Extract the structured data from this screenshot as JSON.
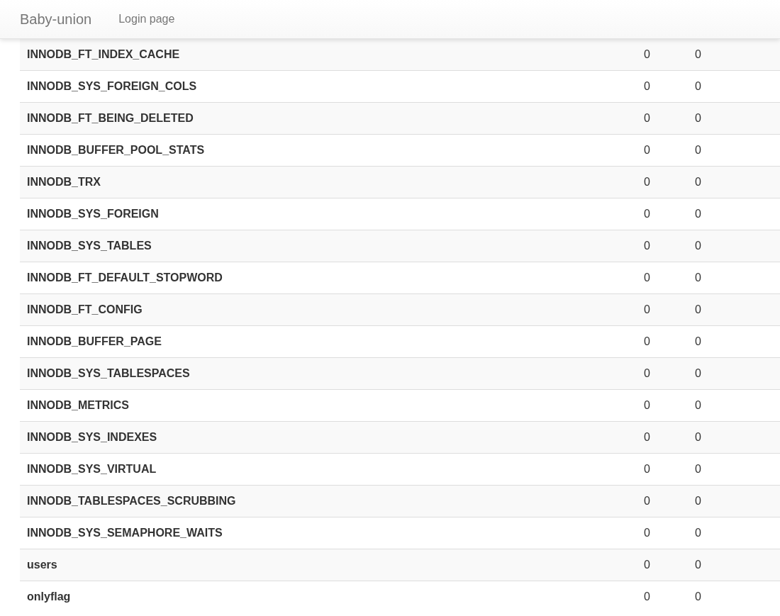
{
  "navbar": {
    "brand": "Baby-union",
    "links": [
      "Login page"
    ]
  },
  "table": {
    "rows": [
      [
        "INNODB_FT_INDEX_CACHE",
        "0",
        "0"
      ],
      [
        "INNODB_SYS_FOREIGN_COLS",
        "0",
        "0"
      ],
      [
        "INNODB_FT_BEING_DELETED",
        "0",
        "0"
      ],
      [
        "INNODB_BUFFER_POOL_STATS",
        "0",
        "0"
      ],
      [
        "INNODB_TRX",
        "0",
        "0"
      ],
      [
        "INNODB_SYS_FOREIGN",
        "0",
        "0"
      ],
      [
        "INNODB_SYS_TABLES",
        "0",
        "0"
      ],
      [
        "INNODB_FT_DEFAULT_STOPWORD",
        "0",
        "0"
      ],
      [
        "INNODB_FT_CONFIG",
        "0",
        "0"
      ],
      [
        "INNODB_BUFFER_PAGE",
        "0",
        "0"
      ],
      [
        "INNODB_SYS_TABLESPACES",
        "0",
        "0"
      ],
      [
        "INNODB_METRICS",
        "0",
        "0"
      ],
      [
        "INNODB_SYS_INDEXES",
        "0",
        "0"
      ],
      [
        "INNODB_SYS_VIRTUAL",
        "0",
        "0"
      ],
      [
        "INNODB_TABLESPACES_SCRUBBING",
        "0",
        "0"
      ],
      [
        "INNODB_SYS_SEMAPHORE_WAITS",
        "0",
        "0"
      ],
      [
        "users",
        "0",
        "0"
      ],
      [
        "onlyflag",
        "0",
        "0"
      ]
    ]
  }
}
